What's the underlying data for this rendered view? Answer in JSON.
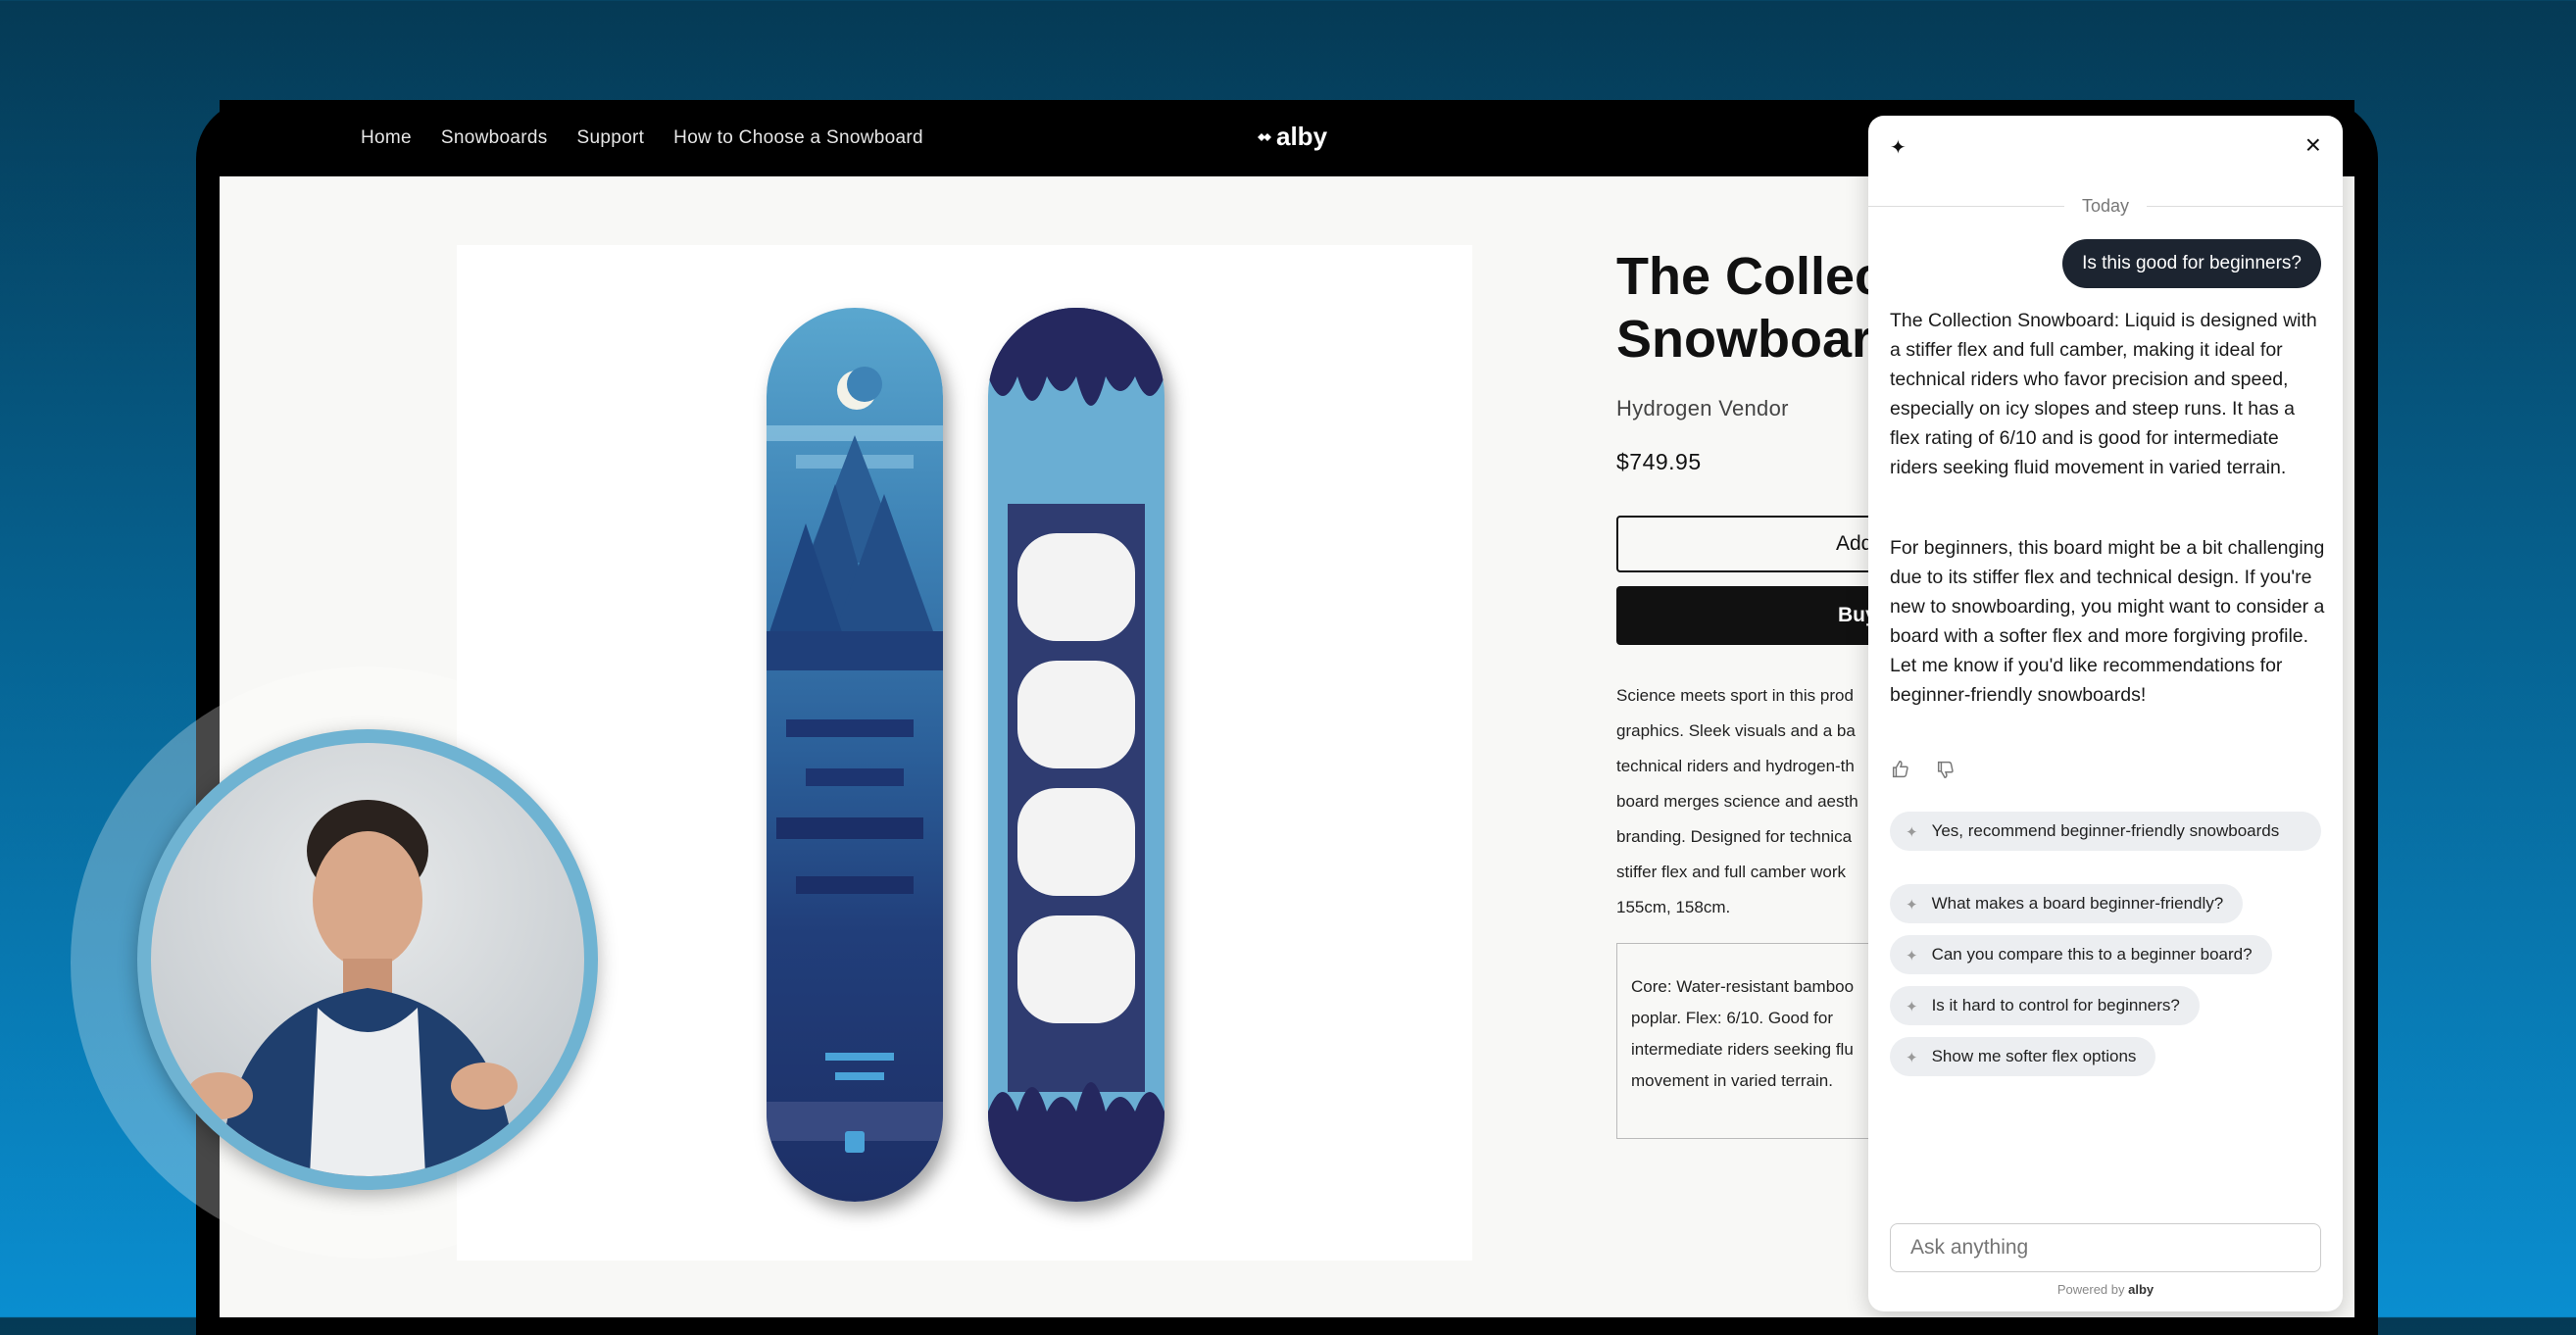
{
  "store": {
    "nav": [
      "Home",
      "Snowboards",
      "Support",
      "How to Choose a Snowboard"
    ],
    "logo": "alby"
  },
  "product": {
    "title": "The Collec\nSnowboard",
    "vendor": "Hydrogen Vendor",
    "price": "$749.95",
    "add_label": "Add",
    "buy_label": "Buy",
    "description_lines": [
      "Science meets sport in this prod",
      "graphics. Sleek visuals and a ba",
      "technical riders and hydrogen-th",
      "board merges science and aesth",
      "branding. Designed for technica",
      "stiffer flex and full camber work",
      "155cm, 158cm."
    ],
    "spec_lines": [
      "Core: Water-resistant bamboo",
      "poplar. Flex: 6/10. Good for",
      "intermediate riders seeking flu",
      "movement in varied terrain."
    ]
  },
  "chat": {
    "day": "Today",
    "user_message": "Is this good for beginners?",
    "bot_paragraph_1": "The Collection Snowboard: Liquid is designed with a stiffer flex and full camber, making it ideal for technical riders who favor precision and speed, especially on icy slopes and steep runs. It has a flex rating of 6/10 and is good for intermediate riders seeking fluid movement in varied terrain.",
    "bot_paragraph_2": "For beginners, this board might be a bit challenging due to its stiffer flex and technical design. If you're new to snowboarding, you might want to consider a board with a softer flex and more forgiving profile. Let me know if you'd like recommendations for beginner-friendly snowboards!",
    "suggestions": [
      "Yes, recommend beginner-friendly snowboards",
      "What makes a board beginner-friendly?",
      "Can you compare this to a beginner board?",
      "Is it hard to control for beginners?",
      "Show me softer flex options"
    ],
    "input_placeholder": "Ask anything",
    "powered_by": "Powered by",
    "powered_brand": "alby"
  },
  "icons": {
    "sparkle": "sparkle-icon",
    "close": "close-icon",
    "thumbs_up": "thumbs-up-icon",
    "thumbs_down": "thumbs-down-icon"
  }
}
